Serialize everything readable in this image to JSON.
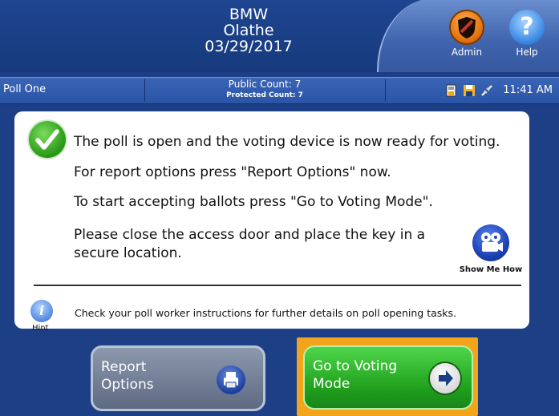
{
  "header": {
    "line1": "BMW",
    "line2": "Olathe",
    "line3": "03/29/2017",
    "admin_label": "Admin",
    "help_label": "Help",
    "admin_icon": "shield-icon",
    "help_icon": "question-icon"
  },
  "status_bar": {
    "poll_name": "Poll One",
    "public_count": "Public Count: 7",
    "protected_count": "Protected Count: 7",
    "icons": [
      "report-icon",
      "save-icon",
      "connection-icon"
    ],
    "time": "11:41 AM"
  },
  "main": {
    "status_icon": "checkmark-icon",
    "message_1": "The poll is open and the voting device is now ready for voting.",
    "message_2": "For report options press \"Report Options\" now.",
    "message_3": "To start accepting ballots press \"Go to Voting Mode\".",
    "message_4": "Please close the access door and place the key in a secure location.",
    "show_me_label": "Show Me How",
    "show_me_icon": "projector-icon",
    "hint_label": "Hint",
    "hint_icon": "info-icon",
    "hint_text": "Check your poll worker instructions for further details on poll opening tasks."
  },
  "buttons": {
    "report_line1": "Report",
    "report_line2": "Options",
    "report_icon": "printer-icon",
    "voting_line1": "Go to Voting",
    "voting_line2": "Mode",
    "voting_icon": "arrow-right-icon"
  },
  "colors": {
    "background": "#1d3f86",
    "accent_orange": "#f2a51b",
    "voting_green": "#1f9e1b",
    "report_gray": "#6f7c93"
  }
}
